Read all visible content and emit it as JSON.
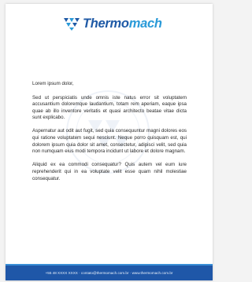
{
  "brand": {
    "name_part1": "Thermo",
    "name_part2": "mach",
    "primary_color": "#1f5aa6",
    "accent_color": "#2a9ad8",
    "logo_icon": "triangle-tiles-icon"
  },
  "letter": {
    "salutation": "Lorem ipsum dolor,",
    "paragraphs": [
      "Sed ut perspiciatis unde omnis iste natus error sit voluptatem accusantium doloremque laudantium, totam rem aperiam, eaque ipsa quae ab illo inventore veritatis et quasi architecto beatae vitae dicta sunt explicabo.",
      "Aspernatur aut odit aut fugit, sed quia consequuntur magni dolores eos qui ratione voluptatem sequi nesciunt. Neque porro quisquam est, qui dolorem ipsum quia dolor sit amet, consectetur, adipisci velit, sed quia non numquam eius modi tempora incidunt ut labore et dolore magnam.",
      "Aliquid ex ea commodi consequatur? Quis autem vel eum iure reprehenderit qui in ea voluptate velit esse quam nihil molestiae consequatur."
    ]
  },
  "footer": {
    "text": "+55 48 XXXX XXXX · contato@thermomach.com.br · www.thermomach.com.br",
    "background": "#1f57a8"
  }
}
